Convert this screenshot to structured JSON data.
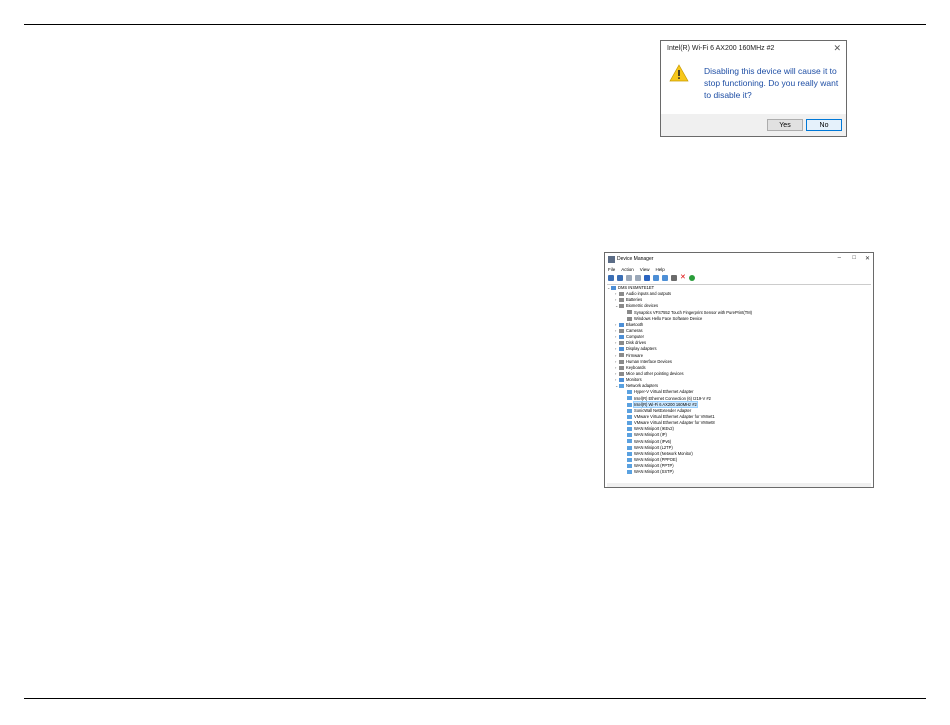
{
  "dialog": {
    "title": "Intel(R) Wi-Fi 6 AX200 160MHz #2",
    "close_glyph": "✕",
    "icon": "warning-icon",
    "message": "Disabling this device will cause it to stop functioning. Do you really want to disable it?",
    "yes_label": "Yes",
    "no_label": "No"
  },
  "device_manager": {
    "title": "Device Manager",
    "window_controls": {
      "minimize": "–",
      "maximize": "□",
      "close": "✕"
    },
    "menu": [
      "File",
      "Action",
      "View",
      "Help"
    ],
    "toolbar_icons": [
      "back-icon",
      "forward-icon",
      "properties-icon",
      "show-hide-icon",
      "help-icon",
      "update-icon",
      "monitor-icon",
      "uninstall-icon",
      "disable-red-x-icon",
      "scan-green-icon"
    ],
    "tree": [
      {
        "label": "DMS INSMNTE1ET",
        "level": 0,
        "exp": "⌄",
        "ico": "computer"
      },
      {
        "label": "Audio inputs and outputs",
        "level": 1,
        "exp": "›",
        "ico": "gray"
      },
      {
        "label": "Batteries",
        "level": 1,
        "exp": "›",
        "ico": "gray"
      },
      {
        "label": "Biometric devices",
        "level": 1,
        "exp": "⌄",
        "ico": "gray"
      },
      {
        "label": "Synaptics VFS7552 Touch Fingerprint Sensor with PurePrint(TM)",
        "level": 2,
        "exp": "",
        "ico": "gray"
      },
      {
        "label": "Windows Hello Face Software Device",
        "level": 2,
        "exp": "",
        "ico": "gray"
      },
      {
        "label": "Bluetooth",
        "level": 1,
        "exp": "›",
        "ico": "blue"
      },
      {
        "label": "Cameras",
        "level": 1,
        "exp": "›",
        "ico": "gray"
      },
      {
        "label": "Computer",
        "level": 1,
        "exp": "›",
        "ico": "blue"
      },
      {
        "label": "Disk drives",
        "level": 1,
        "exp": "›",
        "ico": "gray"
      },
      {
        "label": "Display adapters",
        "level": 1,
        "exp": "›",
        "ico": "blue"
      },
      {
        "label": "Firmware",
        "level": 1,
        "exp": "›",
        "ico": "gray"
      },
      {
        "label": "Human Interface Devices",
        "level": 1,
        "exp": "›",
        "ico": "gray"
      },
      {
        "label": "Keyboards",
        "level": 1,
        "exp": "›",
        "ico": "gray"
      },
      {
        "label": "Mice and other pointing devices",
        "level": 1,
        "exp": "›",
        "ico": "gray"
      },
      {
        "label": "Monitors",
        "level": 1,
        "exp": "›",
        "ico": "blue"
      },
      {
        "label": "Network adapters",
        "level": 1,
        "exp": "⌄",
        "ico": "net"
      },
      {
        "label": "Hyper-V Virtual Ethernet Adapter",
        "level": 2,
        "exp": "",
        "ico": "net"
      },
      {
        "label": "Intel(R) Ethernet Connection (6) I219-V #2",
        "level": 2,
        "exp": "",
        "ico": "net"
      },
      {
        "label": "Intel(R) Wi-Fi 6 AX200 160MHz #2",
        "level": 2,
        "exp": "",
        "ico": "net",
        "selected": true
      },
      {
        "label": "SonicWall NetExtender Adapter",
        "level": 2,
        "exp": "",
        "ico": "net"
      },
      {
        "label": "VMware Virtual Ethernet Adapter for VMnet1",
        "level": 2,
        "exp": "",
        "ico": "net"
      },
      {
        "label": "VMware Virtual Ethernet Adapter for VMnet8",
        "level": 2,
        "exp": "",
        "ico": "net"
      },
      {
        "label": "WAN Miniport (IKEv2)",
        "level": 2,
        "exp": "",
        "ico": "net"
      },
      {
        "label": "WAN Miniport (IP)",
        "level": 2,
        "exp": "",
        "ico": "net"
      },
      {
        "label": "WAN Miniport (IPv6)",
        "level": 2,
        "exp": "",
        "ico": "net"
      },
      {
        "label": "WAN Miniport (L2TP)",
        "level": 2,
        "exp": "",
        "ico": "net"
      },
      {
        "label": "WAN Miniport (Network Monitor)",
        "level": 2,
        "exp": "",
        "ico": "net"
      },
      {
        "label": "WAN Miniport (PPPOE)",
        "level": 2,
        "exp": "",
        "ico": "net"
      },
      {
        "label": "WAN Miniport (PPTP)",
        "level": 2,
        "exp": "",
        "ico": "net"
      },
      {
        "label": "WAN Miniport (SSTP)",
        "level": 2,
        "exp": "",
        "ico": "net"
      }
    ]
  }
}
